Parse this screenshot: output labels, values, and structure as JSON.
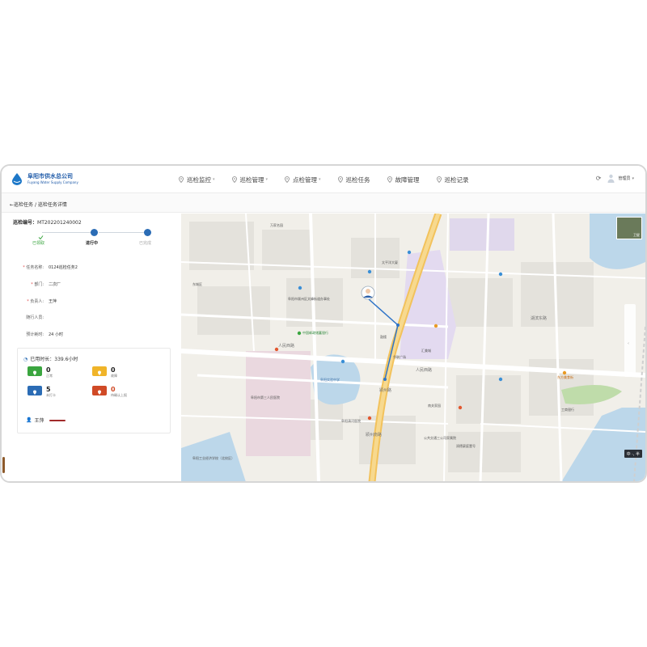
{
  "app": {
    "company_name": "阜阳市供水总公司",
    "company_sub": "Fuyang Water Supply Company"
  },
  "nav": [
    {
      "label": "巡检监控",
      "has_dropdown": true
    },
    {
      "label": "巡检管理",
      "has_dropdown": true
    },
    {
      "label": "点检管理",
      "has_dropdown": true
    },
    {
      "label": "巡检任务",
      "has_dropdown": false
    },
    {
      "label": "故障管理",
      "has_dropdown": false
    },
    {
      "label": "巡检记录",
      "has_dropdown": false
    }
  ],
  "header_right": {
    "user_name": "管理员"
  },
  "breadcrumb": {
    "back": "←巡检任务",
    "sep": " / ",
    "current": "巡检任务详情"
  },
  "task": {
    "number_label": "巡检编号：",
    "number_value": "MT202201240002"
  },
  "steps": [
    {
      "label": "已领取",
      "state": "done"
    },
    {
      "label": "进行中",
      "state": "current"
    },
    {
      "label": "已完成",
      "state": "pending"
    }
  ],
  "fields": [
    {
      "key": "任务名称:",
      "value": "0124巡检任务2",
      "required": true
    },
    {
      "key": "部门:",
      "value": "二次厂",
      "required": true
    },
    {
      "key": "负责人:",
      "value": "王萍",
      "required": true
    },
    {
      "key": "随行人员:",
      "value": "",
      "required": false
    },
    {
      "key": "预计耗时:",
      "value": "24 小时",
      "required": false
    }
  ],
  "stats": {
    "used_time_label": "已用时长：339.6小时",
    "items": [
      {
        "num": "0",
        "cap": "正常",
        "color": "#3aa53f"
      },
      {
        "num": "0",
        "cap": "故障",
        "color": "#f0b429"
      },
      {
        "num": "5",
        "cap": "未打卡",
        "color": "#2b6cb5"
      },
      {
        "num": "0",
        "cap": "待确认上报",
        "color": "#d04a26"
      }
    ],
    "person": "王萍"
  },
  "map": {
    "labels": [
      {
        "t": "东城区",
        "c": "poi"
      },
      {
        "t": "万家名园",
        "c": "poi"
      },
      {
        "t": "人民西路",
        "c": "road"
      },
      {
        "t": "人民西路",
        "c": "road"
      },
      {
        "t": "中国邮政储蓄银行",
        "c": "green"
      },
      {
        "t": "阜阳实验中学",
        "c": "blue"
      },
      {
        "t": "阜阳市第三人民医院",
        "c": "poi"
      },
      {
        "t": "阜阳工业经济学校（北校区）",
        "c": "poi"
      },
      {
        "t": "汇美城",
        "c": "poi"
      },
      {
        "t": "华联广场",
        "c": "poi"
      },
      {
        "t": "太平洋大厦",
        "c": "poi"
      },
      {
        "t": "阜阳市颍州区文峰街道办事处",
        "c": "poi"
      },
      {
        "t": "颍州路",
        "c": "road"
      },
      {
        "t": "鼓楼",
        "c": "poi"
      },
      {
        "t": "南关家园",
        "c": "poi"
      },
      {
        "t": "东方美食街",
        "c": "orange"
      },
      {
        "t": "阜阳清河医院",
        "c": "poi"
      },
      {
        "t": "公共交通三公司家属院",
        "c": "poi"
      },
      {
        "t": "润德豪庭壹号",
        "c": "poi"
      },
      {
        "t": "湖滨东路",
        "c": "road"
      },
      {
        "t": "颍州南路",
        "c": "road"
      },
      {
        "t": "工商银行",
        "c": "poi"
      }
    ],
    "ime_text": "中 ·, 半",
    "thumb_label": "卫星"
  }
}
